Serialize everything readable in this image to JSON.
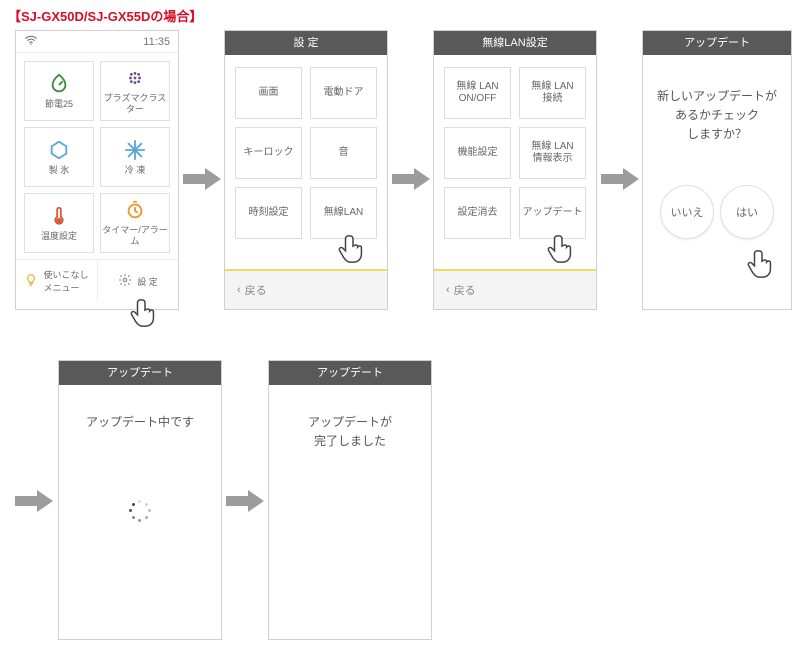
{
  "title": "【SJ-GX50D/SJ-GX55Dの場合】",
  "time": "11:35",
  "home_tiles": [
    "節電25",
    "プラズマクラスター",
    "製 氷",
    "冷 凍",
    "温度設定",
    "タイマー/アラーム"
  ],
  "home_menu": {
    "tips": "使いこなし\nメニュー",
    "settings": "設 定"
  },
  "icon": {
    "gear": "gear-icon",
    "bulb": "lightbulb-icon",
    "wifi": "wifi-icon"
  },
  "s2": {
    "title": "設 定",
    "buttons": [
      "画面",
      "電動ドア",
      "キーロック",
      "音",
      "時刻設定",
      "無線LAN"
    ],
    "back": "戻る"
  },
  "s3": {
    "title": "無線LAN設定",
    "buttons": [
      "無線 LAN\nON/OFF",
      "無線 LAN\n接続",
      "機能設定",
      "無線 LAN\n情報表示",
      "設定消去",
      "アップデート"
    ],
    "back": "戻る"
  },
  "s4": {
    "title": "アップデート",
    "msg": "新しいアップデートが\nあるかチェック\nしますか？",
    "no": "いいえ",
    "yes": "はい"
  },
  "s5": {
    "title": "アップデート",
    "msg": "アップデート中です"
  },
  "s6": {
    "title": "アップデート",
    "msg": "アップデートが\n完了しました"
  }
}
